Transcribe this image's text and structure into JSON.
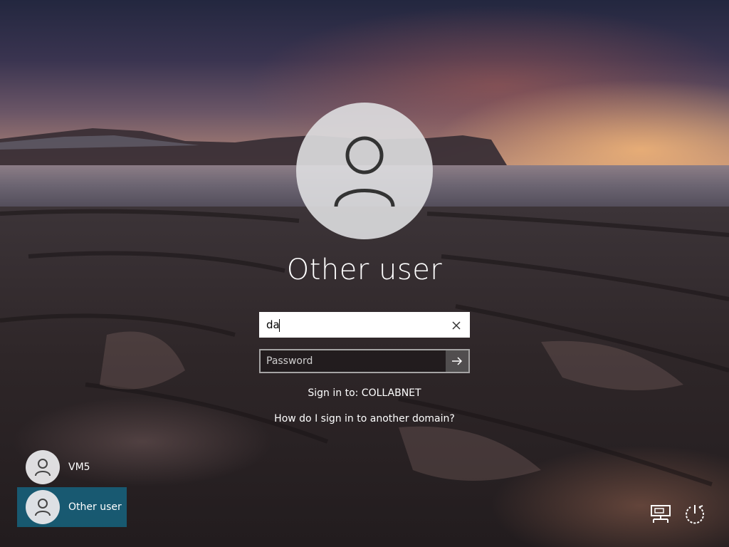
{
  "login": {
    "title": "Other user",
    "username_value": "da",
    "password_placeholder": "Password",
    "sign_in_to": "Sign in to: COLLABNET",
    "domain_help_link": "How do I sign in to another domain?"
  },
  "users": [
    {
      "label": "VM5",
      "selected": false
    },
    {
      "label": "Other user",
      "selected": true
    }
  ],
  "icons": {
    "network": "network-icon",
    "power": "power-icon",
    "clear": "close-icon",
    "submit": "arrow-right-icon",
    "avatar": "person-icon"
  },
  "colors": {
    "selected_user": "#146e8c"
  }
}
